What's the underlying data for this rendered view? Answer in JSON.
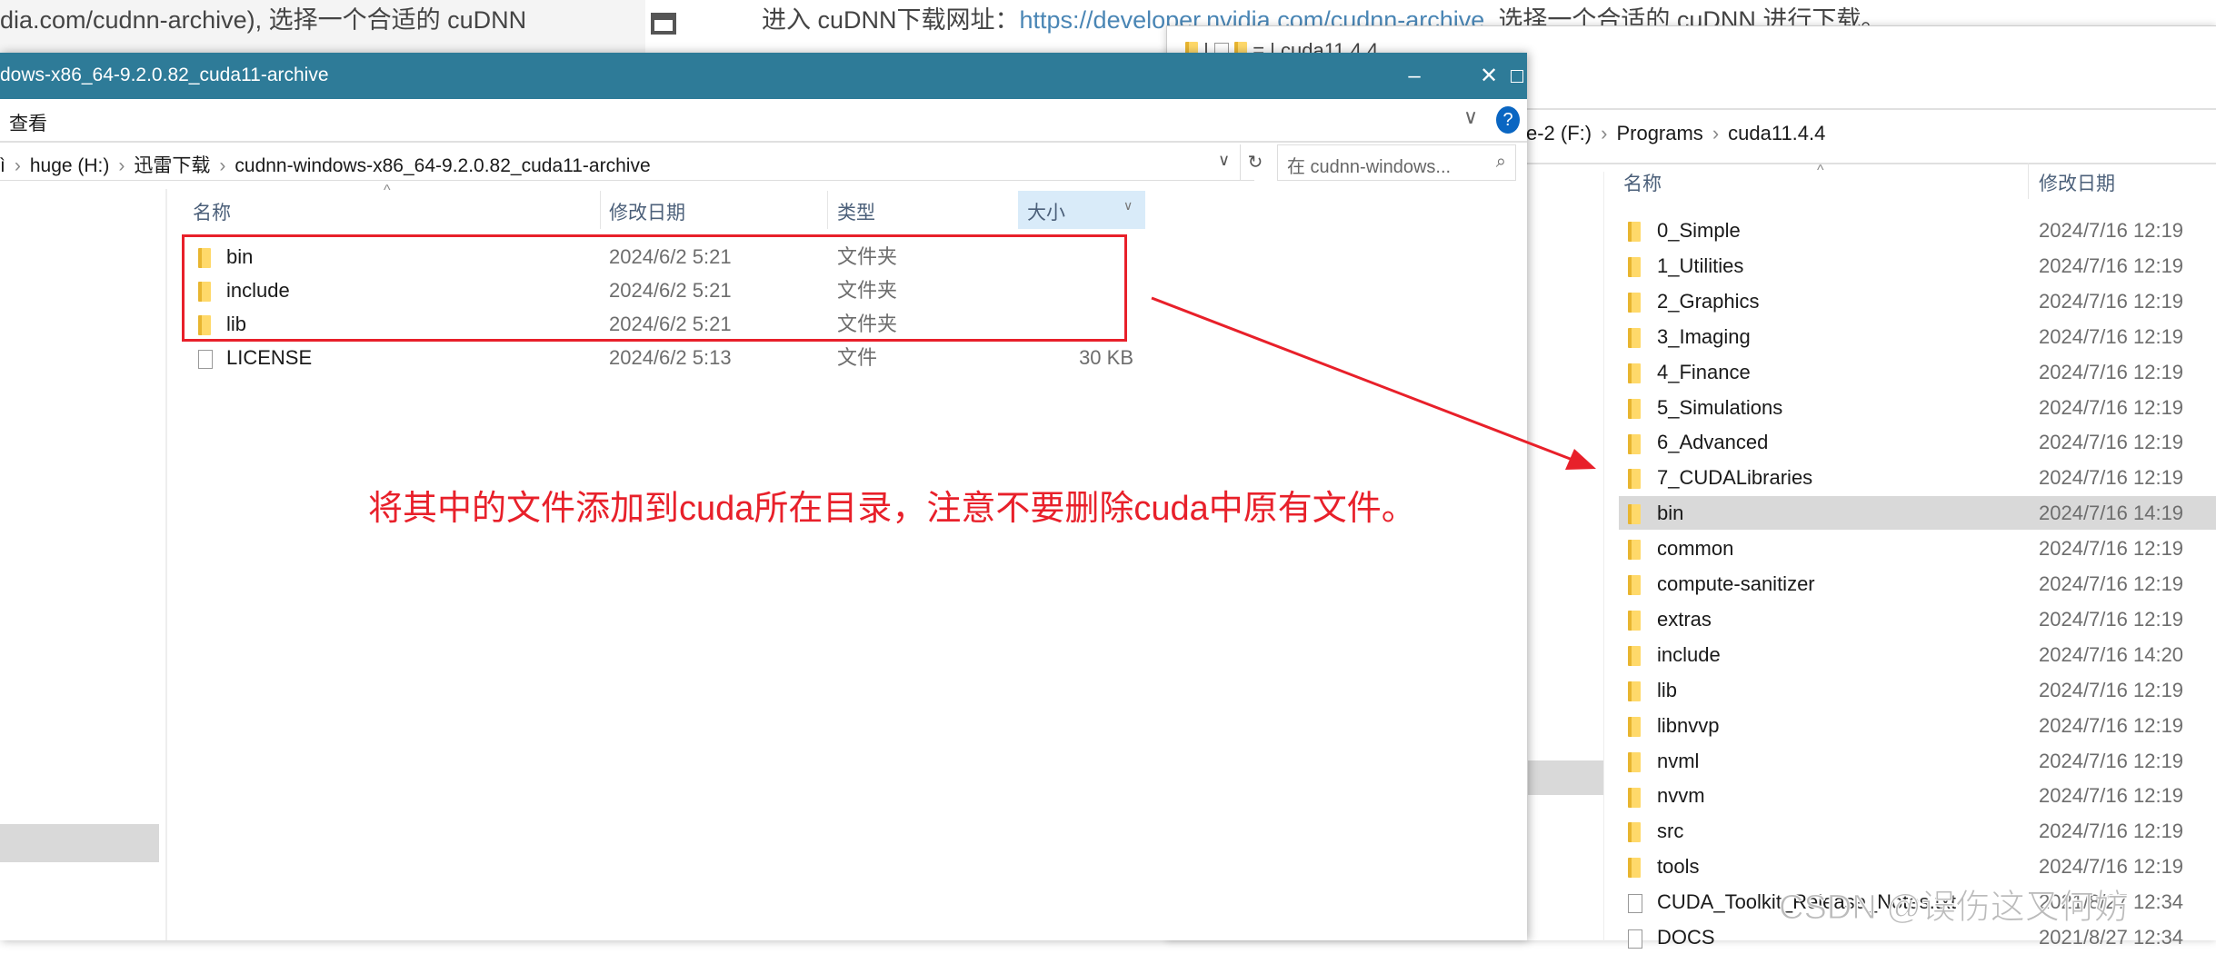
{
  "background_doc": {
    "left_text": "dia.com/cudnn-archive), 选择一个合适的 cuDNN",
    "right_prefix": "进入 cuDNN下载网址：",
    "right_link": "https://developer.nvidia.com/cudnn-archive",
    "right_suffix": ", 选择一个合适的 cuDNN 进行下载。"
  },
  "right_window": {
    "title": "cuda11.4.4",
    "breadcrumb": [
      "e-2 (F:)",
      "Programs",
      "cuda11.4.4"
    ],
    "columns": {
      "name": "名称",
      "date": "修改日期"
    },
    "rows": [
      {
        "name": "0_Simple",
        "date": "2024/7/16 12:19",
        "kind": "folder"
      },
      {
        "name": "1_Utilities",
        "date": "2024/7/16 12:19",
        "kind": "folder"
      },
      {
        "name": "2_Graphics",
        "date": "2024/7/16 12:19",
        "kind": "folder"
      },
      {
        "name": "3_Imaging",
        "date": "2024/7/16 12:19",
        "kind": "folder"
      },
      {
        "name": "4_Finance",
        "date": "2024/7/16 12:19",
        "kind": "folder"
      },
      {
        "name": "5_Simulations",
        "date": "2024/7/16 12:19",
        "kind": "folder"
      },
      {
        "name": "6_Advanced",
        "date": "2024/7/16 12:19",
        "kind": "folder"
      },
      {
        "name": "7_CUDALibraries",
        "date": "2024/7/16 12:19",
        "kind": "folder"
      },
      {
        "name": "bin",
        "date": "2024/7/16 14:19",
        "kind": "folder",
        "selected": true
      },
      {
        "name": "common",
        "date": "2024/7/16 12:19",
        "kind": "folder"
      },
      {
        "name": "compute-sanitizer",
        "date": "2024/7/16 12:19",
        "kind": "folder"
      },
      {
        "name": "extras",
        "date": "2024/7/16 12:19",
        "kind": "folder"
      },
      {
        "name": "include",
        "date": "2024/7/16 14:20",
        "kind": "folder"
      },
      {
        "name": "lib",
        "date": "2024/7/16 12:19",
        "kind": "folder"
      },
      {
        "name": "libnvvp",
        "date": "2024/7/16 12:19",
        "kind": "folder"
      },
      {
        "name": "nvml",
        "date": "2024/7/16 12:19",
        "kind": "folder"
      },
      {
        "name": "nvvm",
        "date": "2024/7/16 12:19",
        "kind": "folder"
      },
      {
        "name": "src",
        "date": "2024/7/16 12:19",
        "kind": "folder"
      },
      {
        "name": "tools",
        "date": "2024/7/16 12:19",
        "kind": "folder"
      },
      {
        "name": "CUDA_Toolkit_Release_Notes.txt",
        "date": "2021/8/27 12:34",
        "kind": "text-file"
      },
      {
        "name": "DOCS",
        "date": "2021/8/27 12:34",
        "kind": "file"
      }
    ]
  },
  "left_window": {
    "title": "dows-x86_64-9.2.0.82_cuda11-archive",
    "ribbon_tab": "查看",
    "breadcrumb": [
      "ì",
      "huge (H:)",
      "迅雷下载",
      "cudnn-windows-x86_64-9.2.0.82_cuda11-archive"
    ],
    "search_placeholder": "在 cudnn-windows...",
    "columns": {
      "name": "名称",
      "date": "修改日期",
      "type": "类型",
      "size": "大小"
    },
    "rows": [
      {
        "name": "bin",
        "date": "2024/6/2 5:21",
        "type": "文件夹",
        "size": "",
        "kind": "folder"
      },
      {
        "name": "include",
        "date": "2024/6/2 5:21",
        "type": "文件夹",
        "size": "",
        "kind": "folder"
      },
      {
        "name": "lib",
        "date": "2024/6/2 5:21",
        "type": "文件夹",
        "size": "",
        "kind": "folder"
      },
      {
        "name": "LICENSE",
        "date": "2024/6/2 5:13",
        "type": "文件",
        "size": "30 KB",
        "kind": "file"
      }
    ]
  },
  "annotation": {
    "text": "将其中的文件添加到cuda所在目录，注意不要删除cuda中原有文件。",
    "color": "#e8202a"
  },
  "watermark": "CSDN @误伤这又何妨",
  "colors": {
    "titlebar": "#2e7b98",
    "selected_row": "#d9d9d9",
    "sorted_column": "#d9ebf9"
  }
}
